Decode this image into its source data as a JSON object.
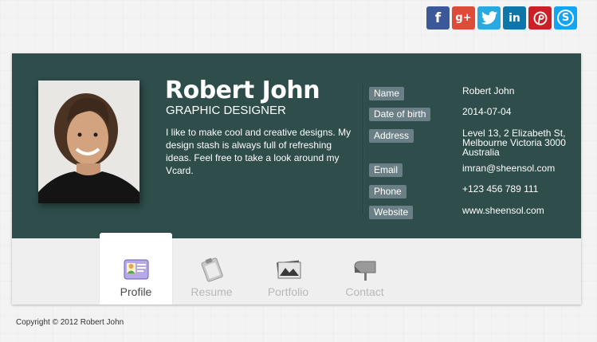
{
  "social": [
    {
      "name": "facebook",
      "glyph": "f",
      "color": "#3b5998"
    },
    {
      "name": "googleplus",
      "glyph": "g+",
      "color": "#dd4b39"
    },
    {
      "name": "twitter",
      "glyph": "t",
      "color": "#2aa9e0"
    },
    {
      "name": "linkedin",
      "glyph": "in",
      "color": "#0e76a8"
    },
    {
      "name": "pinterest",
      "glyph": "p",
      "color": "#cb2027"
    },
    {
      "name": "skype",
      "glyph": "S",
      "color": "#12a5f4"
    }
  ],
  "profile": {
    "name": "Robert John",
    "title": "GRAPHIC DESIGNER",
    "bio": "I like to make cool and creative designs. My design stash is always full of refreshing ideas. Feel free to take a look around my Vcard."
  },
  "details": {
    "name_label": "Name",
    "name_value": "Robert John",
    "dob_label": "Date of birth",
    "dob_value": "2014-07-04",
    "address_label": "Address",
    "address_value": "Level 13, 2 Elizabeth St, Melbourne Victoria 3000 Australia",
    "email_label": "Email",
    "email_value": "imran@sheensol.com",
    "phone_label": "Phone",
    "phone_value": "+123 456 789 111",
    "website_label": "Website",
    "website_value": "www.sheensol.com"
  },
  "tabs": {
    "profile": "Profile",
    "resume": "Resume",
    "portfolio": "Portfolio",
    "contact": "Contact"
  },
  "footer": {
    "copyright": "Copyright © 2012 Robert John"
  },
  "colors": {
    "header_bg": "#2e4d4b",
    "label_bg": "#6a7f86",
    "tabs_bg": "#efefef"
  }
}
